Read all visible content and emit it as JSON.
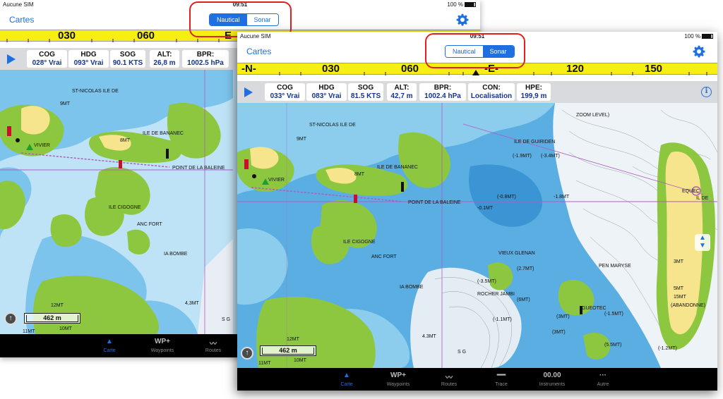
{
  "back_screen": {
    "status": {
      "carrier": "Aucune SIM",
      "time": "09:51",
      "battery": "100 %"
    },
    "nav": {
      "back_label": "Cartes",
      "seg_nautical": "Nautical",
      "seg_sonar": "Sonar",
      "selected": "Nautical"
    },
    "compass": {
      "ticks": [
        "030",
        "060",
        "E"
      ]
    },
    "data_boxes": [
      {
        "label": "COG",
        "value": "028° Vrai"
      },
      {
        "label": "HDG",
        "value": "093° Vrai"
      },
      {
        "label": "SOG",
        "value": "90.1 KTS"
      },
      {
        "label": "ALT:",
        "value": "26,8 m"
      },
      {
        "label": "BPR:",
        "value": "1002.5 hPa"
      }
    ],
    "map_labels": [
      "ST-NICOLAS ILE DE",
      "ILE DE BANANEC",
      "VIVIER",
      "POINT DE LA BALEINE",
      "ILE CIGOGNE",
      "ANC FORT",
      "IA BOMBE",
      "9MT",
      "8MT",
      "12MT",
      "11MT",
      "10MT",
      "4,3MT",
      "S G"
    ],
    "scale_label": "462 m",
    "tabs": [
      {
        "icon": "▲",
        "label": "Carte"
      },
      {
        "icon": "WP+",
        "label": "Waypoints"
      },
      {
        "icon": "〰",
        "label": "Routes"
      }
    ]
  },
  "front_screen": {
    "status": {
      "carrier": "Aucune SIM",
      "time": "09:51",
      "battery": "100 %"
    },
    "nav": {
      "back_label": "Cartes",
      "seg_nautical": "Nautical",
      "seg_sonar": "Sonar",
      "selected": "Sonar"
    },
    "compass": {
      "ticks": [
        "-N-",
        "030",
        "060",
        "-E-",
        "120",
        "150"
      ]
    },
    "data_boxes": [
      {
        "label": "COG",
        "value": "033° Vrai"
      },
      {
        "label": "HDG",
        "value": "083° Vrai"
      },
      {
        "label": "SOG",
        "value": "81.5 KTS"
      },
      {
        "label": "ALT:",
        "value": "42,7 m"
      },
      {
        "label": "BPR:",
        "value": "1002.4 hPa"
      },
      {
        "label": "CON:",
        "value": "Localisation"
      },
      {
        "label": "HPE:",
        "value": "199,9 m"
      }
    ],
    "map_labels": [
      "ST-NICOLAS ILE DE",
      "ILE DE BANANEC",
      "VIVIER",
      "POINT DE LA BALEINE",
      "ILE CIGOGNE",
      "ANC FORT",
      "IA BOMBE",
      "ILE DE GUIRIDEN",
      "VIEUX GLENAN",
      "ROCHER JAMBI",
      "PEN MARYSE",
      "GUEOTEC",
      "(ABANDONNE)",
      "ZOOM LEVEL)",
      "EQUEC",
      "IL DE",
      "(-1.9MT)",
      "(-3.4MT)",
      "(-0.8MT)",
      "-1.8MT",
      "-0.1MT",
      "(-3.5MT)",
      "(-1.5MT)",
      "(-1.2MT)",
      "(6MT)",
      "(2.7MT)",
      "(3MT)",
      "(3MT)",
      "(5.5MT)",
      "5MT",
      "3MT",
      "15MT",
      "(-1.1MT)",
      "12MT",
      "11MT",
      "10MT",
      "4.3MT",
      "S G",
      "9MT",
      "8MT"
    ],
    "scale_label": "462 m",
    "tabs": [
      {
        "icon": "▲",
        "label": "Carte"
      },
      {
        "icon": "WP+",
        "label": "Waypoints"
      },
      {
        "icon": "〰",
        "label": "Routes"
      },
      {
        "icon": "━━",
        "label": "Trace"
      },
      {
        "icon": "00.00",
        "label": "Instruments"
      },
      {
        "icon": "···",
        "label": "Autre"
      }
    ]
  },
  "colors": {
    "land": "#f6e58d",
    "shoal": "#8dc73f",
    "deep": "#bfe3f6",
    "mid": "#7cc4ec",
    "shallow": "#4aa8e0",
    "highlight": "#e0201b",
    "accent": "#1e6fe0",
    "compass": "#f7ee14"
  }
}
